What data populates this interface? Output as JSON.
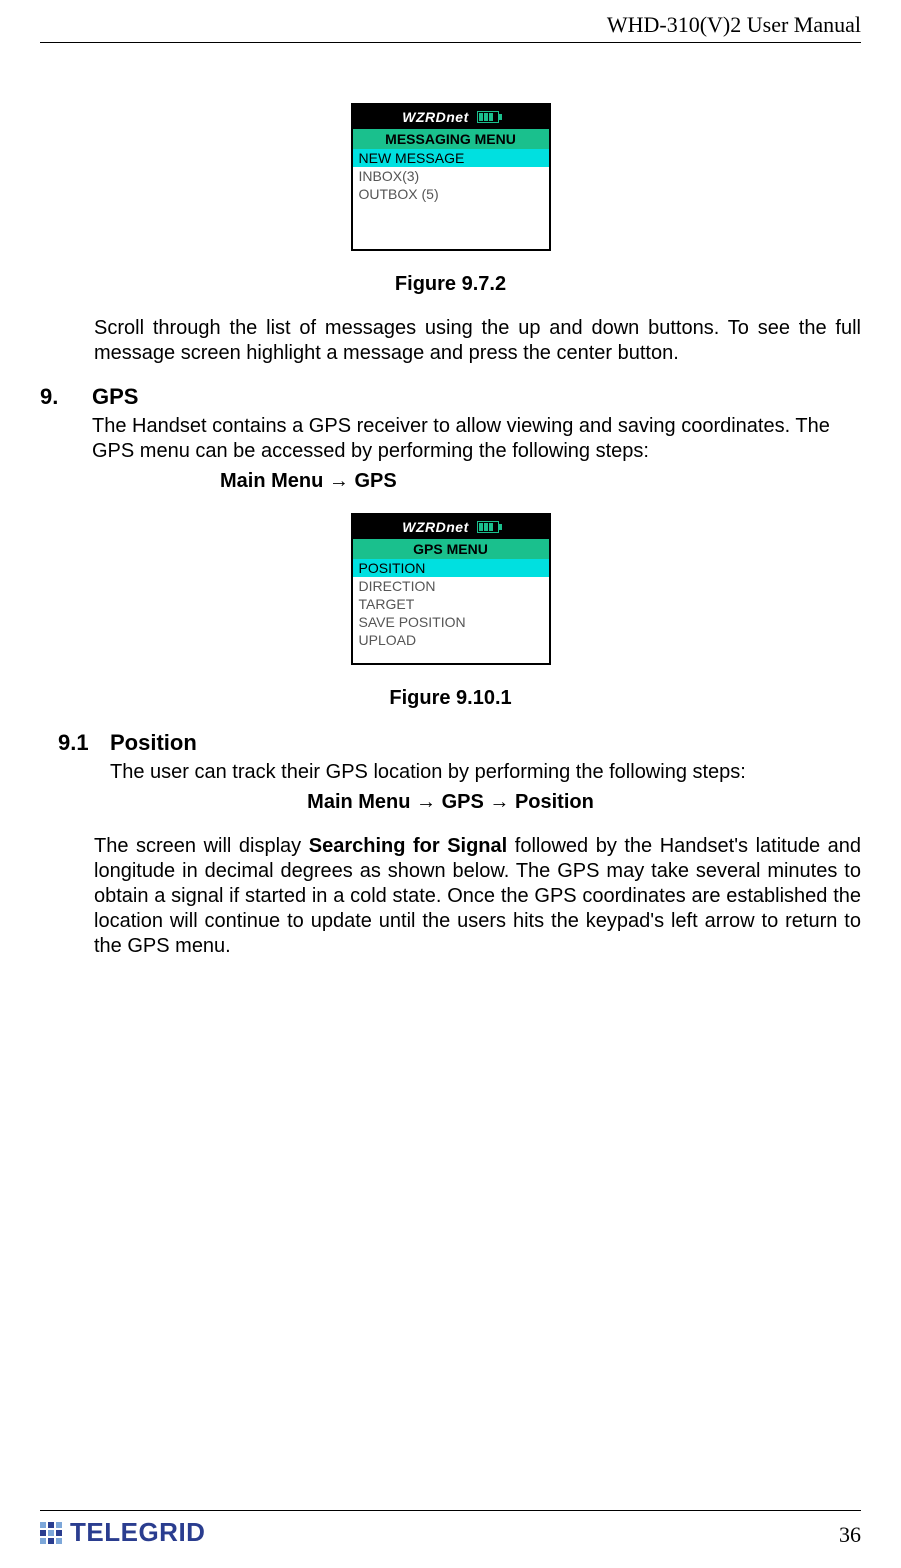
{
  "header": {
    "title": "WHD-310(V)2 User Manual"
  },
  "phone1": {
    "brand": "WZRDnet",
    "title": "MESSAGING MENU",
    "items": [
      {
        "label": "NEW MESSAGE",
        "selected": true
      },
      {
        "label": "INBOX(3)",
        "selected": false
      },
      {
        "label": "OUTBOX (5)",
        "selected": false
      }
    ]
  },
  "caption1": "Figure 9.7.2",
  "para1": "Scroll through the list of messages using the up and down buttons.  To see the full message screen highlight a message and press the center button.",
  "section9": {
    "num": "9.",
    "title": "GPS",
    "para": "The Handset contains a GPS receiver to allow viewing and saving coordinates.  The GPS menu can be accessed by performing the following steps:",
    "nav": "Main Menu → GPS"
  },
  "phone2": {
    "brand": "WZRDnet",
    "title": "GPS MENU",
    "items": [
      {
        "label": "POSITION",
        "selected": true
      },
      {
        "label": "DIRECTION",
        "selected": false
      },
      {
        "label": "TARGET",
        "selected": false
      },
      {
        "label": "SAVE POSITION",
        "selected": false
      },
      {
        "label": "UPLOAD",
        "selected": false
      }
    ]
  },
  "caption2": "Figure 9.10.1",
  "section91": {
    "num": "9.1",
    "title": "Position",
    "para1": "The user can track their GPS location by performing the following steps:",
    "nav": "Main Menu → GPS → Position",
    "para2a": "The screen will display ",
    "para2bold": "Searching for Signal",
    "para2b": " followed by the Handset's latitude and longitude in decimal degrees as shown below.  The GPS may take several minutes to obtain a signal if started in a cold state.  Once the GPS coordinates are established the location will continue to update until the users hits the keypad's left arrow to return to the GPS menu."
  },
  "footer": {
    "logo": "TELEGRID",
    "page": "36"
  }
}
